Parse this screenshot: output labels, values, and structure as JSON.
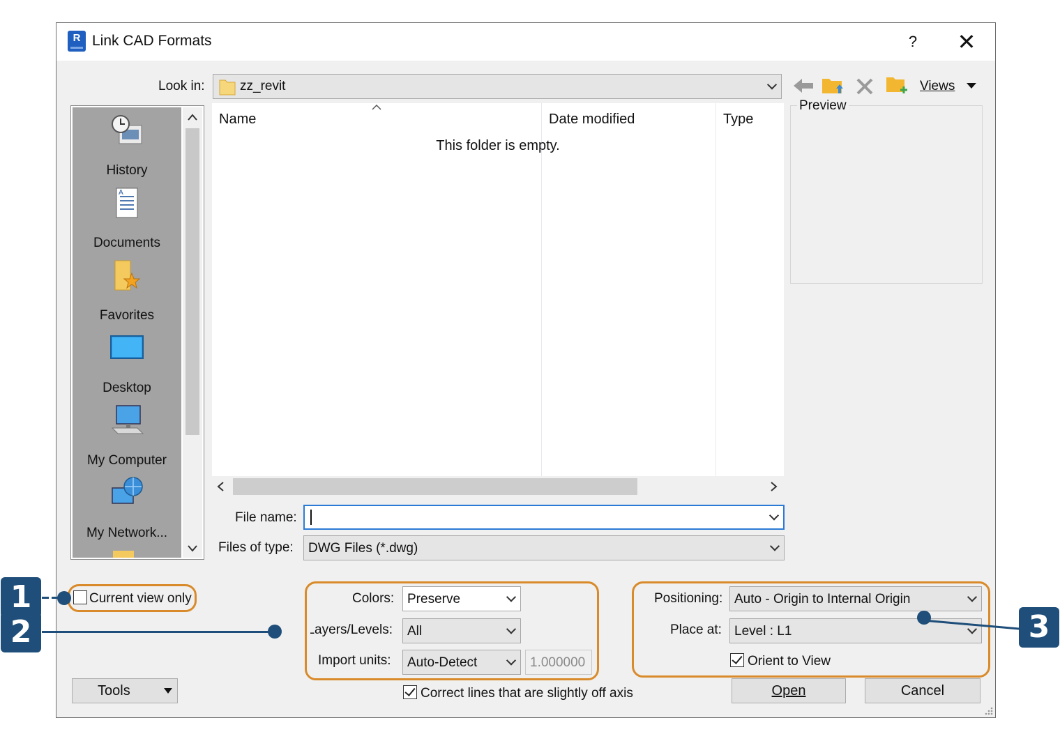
{
  "window": {
    "title": "Link CAD Formats",
    "help": "?",
    "close": "✕"
  },
  "lookin": {
    "label": "Look in:",
    "value": "zz_revit"
  },
  "toolbar": {
    "views": "Views"
  },
  "places": [
    {
      "label": "History",
      "icon": "history-icon"
    },
    {
      "label": "Documents",
      "icon": "documents-icon"
    },
    {
      "label": "Favorites",
      "icon": "favorites-icon"
    },
    {
      "label": "Desktop",
      "icon": "desktop-icon"
    },
    {
      "label": "My Computer",
      "icon": "my-computer-icon"
    },
    {
      "label": "My Network...",
      "icon": "my-network-icon"
    }
  ],
  "filelist": {
    "columns": [
      "Name",
      "Date modified",
      "Type"
    ],
    "empty_message": "This folder is empty."
  },
  "preview": {
    "label": "Preview"
  },
  "filename": {
    "label": "File name:",
    "value": ""
  },
  "filetype": {
    "label": "Files of type:",
    "value": "DWG Files (*.dwg)"
  },
  "options": {
    "current_view_only": "Current view only",
    "colors_label": "Colors:",
    "colors_value": "Preserve",
    "layers_label": "Layers/Levels:",
    "layers_value": "All",
    "units_label": "Import units:",
    "units_value": "Auto-Detect",
    "scale_value": "1.000000",
    "correct_lines": "Correct lines that are slightly off axis",
    "positioning_label": "Positioning:",
    "positioning_value": "Auto - Origin to Internal Origin",
    "place_at_label": "Place at:",
    "place_at_value": "Level : L1",
    "orient_to_view": "Orient to View"
  },
  "buttons": {
    "tools": "Tools",
    "open": "Open",
    "cancel": "Cancel"
  },
  "callouts": [
    "1",
    "2",
    "3"
  ],
  "colors": {
    "callout": "#1e4e79",
    "highlight": "#d98b2b"
  }
}
